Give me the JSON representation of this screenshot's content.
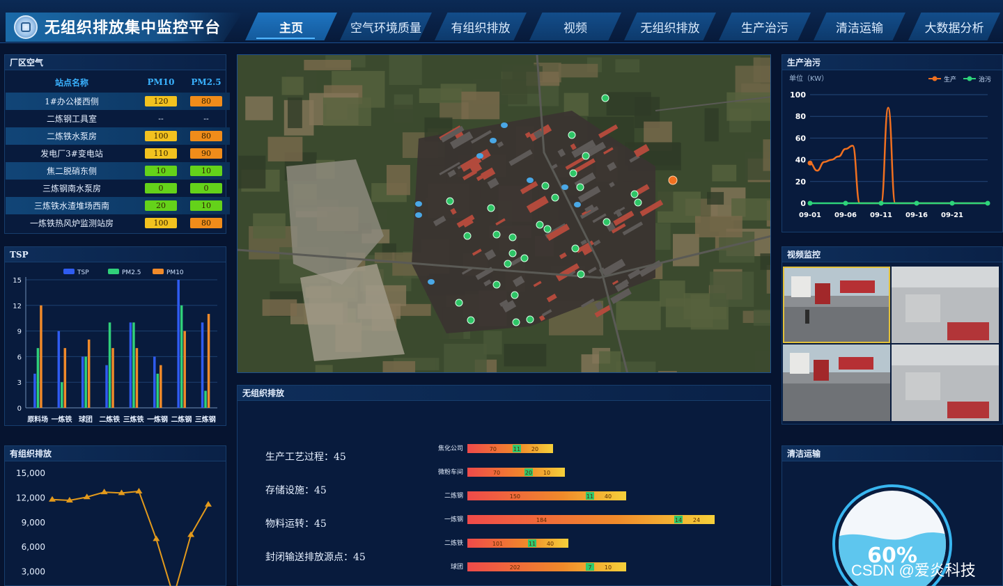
{
  "header": {
    "title": "无组织排放集中监控平台",
    "nav": [
      {
        "label": "主页",
        "active": true
      },
      {
        "label": "空气环境质量",
        "active": false
      },
      {
        "label": "有组织排放",
        "active": false
      },
      {
        "label": "视频",
        "active": false
      },
      {
        "label": "无组织排放",
        "active": false
      },
      {
        "label": "生产治污",
        "active": false
      },
      {
        "label": "清洁运输",
        "active": false
      },
      {
        "label": "大数据分析",
        "active": false
      }
    ]
  },
  "air": {
    "title": "厂区空气",
    "headers": {
      "name": "站点名称",
      "pm10": "PM10",
      "pm25": "PM2.5"
    },
    "rows": [
      {
        "name": "1#办公楼西侧",
        "pm10": "120",
        "pm25": "80",
        "pm10_color": "#f2c21f",
        "pm25_color": "#f08c1a"
      },
      {
        "name": "二炼钢工具室",
        "pm10": "--",
        "pm25": "--",
        "pm10_color": "",
        "pm25_color": ""
      },
      {
        "name": "二炼铁水泵房",
        "pm10": "100",
        "pm25": "80",
        "pm10_color": "#f2c21f",
        "pm25_color": "#f08c1a"
      },
      {
        "name": "发电厂3#变电站",
        "pm10": "110",
        "pm25": "90",
        "pm10_color": "#f2c21f",
        "pm25_color": "#f08c1a"
      },
      {
        "name": "焦二脱硝东侧",
        "pm10": "10",
        "pm25": "10",
        "pm10_color": "#64d21a",
        "pm25_color": "#64d21a"
      },
      {
        "name": "三炼钢南水泵房",
        "pm10": "0",
        "pm25": "0",
        "pm10_color": "#64d21a",
        "pm25_color": "#64d21a"
      },
      {
        "name": "三炼铁水渣堆场西南",
        "pm10": "20",
        "pm25": "10",
        "pm10_color": "#64d21a",
        "pm25_color": "#64d21a"
      },
      {
        "name": "一炼铁热风炉监测站房",
        "pm10": "100",
        "pm25": "80",
        "pm10_color": "#f2c21f",
        "pm25_color": "#f08c1a"
      }
    ]
  },
  "tsp": {
    "title": "TSP"
  },
  "organized": {
    "title": "有组织排放"
  },
  "production": {
    "title": "生产治污",
    "unit": "单位（KW）"
  },
  "video": {
    "title": "视频监控"
  },
  "fugitive": {
    "title": "无组织排放",
    "stats": [
      {
        "label": "生产工艺过程：",
        "value": "45"
      },
      {
        "label": "存储设施：",
        "value": "45"
      },
      {
        "label": "物料运转：",
        "value": "45"
      },
      {
        "label": "封闭输送排放源点：",
        "value": "45"
      }
    ]
  },
  "clean": {
    "title": "清洁运输",
    "percent": "60%",
    "level": 0.6
  },
  "watermark": "CSDN @爱炎科技",
  "chart_data": [
    {
      "id": "tsp",
      "type": "bar",
      "categories": [
        "原料场",
        "一炼铁",
        "球团",
        "二炼铁",
        "三炼铁",
        "一炼钢",
        "二炼钢",
        "三炼钢"
      ],
      "series": [
        {
          "name": "TSP",
          "color": "#2f5cf0",
          "values": [
            4,
            9,
            6,
            5,
            10,
            6,
            15,
            10
          ]
        },
        {
          "name": "PM2.5",
          "color": "#30d07a",
          "values": [
            7,
            3,
            6,
            10,
            10,
            4,
            12,
            2
          ]
        },
        {
          "name": "PM10",
          "color": "#f08a2a",
          "values": [
            12,
            7,
            8,
            7,
            7,
            5,
            9,
            11
          ]
        }
      ],
      "yticks": [
        "0",
        "3",
        "6",
        "9",
        "12",
        "15"
      ],
      "ylim": [
        0,
        15
      ],
      "legend": "top"
    },
    {
      "id": "organized",
      "type": "line",
      "color": "#e39a1c",
      "values": [
        11800,
        11700,
        12100,
        12700,
        12600,
        12800,
        7000,
        0,
        7500,
        11200
      ],
      "yticks": [
        "3,000",
        "6,000",
        "9,000",
        "12,000",
        "15,000"
      ],
      "ylim": [
        0,
        15000
      ]
    },
    {
      "id": "production",
      "type": "line",
      "series": [
        {
          "name": "生产",
          "color": "#f07020",
          "values": [
            37,
            30,
            38,
            40,
            43,
            50,
            53,
            0,
            0,
            0,
            0,
            88,
            0,
            0,
            0,
            0,
            0,
            0,
            0,
            0,
            0,
            0,
            0,
            0,
            0,
            0
          ]
        },
        {
          "name": "治污",
          "color": "#2ed47a",
          "values": [
            0,
            0,
            0,
            0,
            0,
            0,
            0,
            0,
            0,
            0,
            0,
            0,
            0,
            0,
            0,
            0,
            0,
            0,
            0,
            0,
            0,
            0,
            0,
            0,
            0,
            0
          ]
        }
      ],
      "xticks": [
        "09-01",
        "09-06",
        "09-11",
        "09-16",
        "09-21"
      ],
      "yticks": [
        "0",
        "20",
        "40",
        "60",
        "80",
        "100"
      ],
      "ylim": [
        0,
        100
      ],
      "legend": "top-right"
    },
    {
      "id": "fugitive-bars",
      "type": "bar",
      "orientation": "horizontal",
      "categories": [
        "焦化公司",
        "微粉车间",
        "二炼钢",
        "一炼钢",
        "二炼铁",
        "球团"
      ],
      "segments": [
        [
          "70",
          "11",
          "20"
        ],
        [
          "70",
          "20",
          "10"
        ],
        [
          "150",
          "11",
          "40"
        ],
        [
          "184",
          "14",
          "24"
        ],
        [
          "101",
          "11",
          "40"
        ],
        [
          "202",
          "7",
          "10"
        ]
      ],
      "totals": [
        123,
        140,
        228,
        355,
        145,
        228
      ]
    }
  ]
}
